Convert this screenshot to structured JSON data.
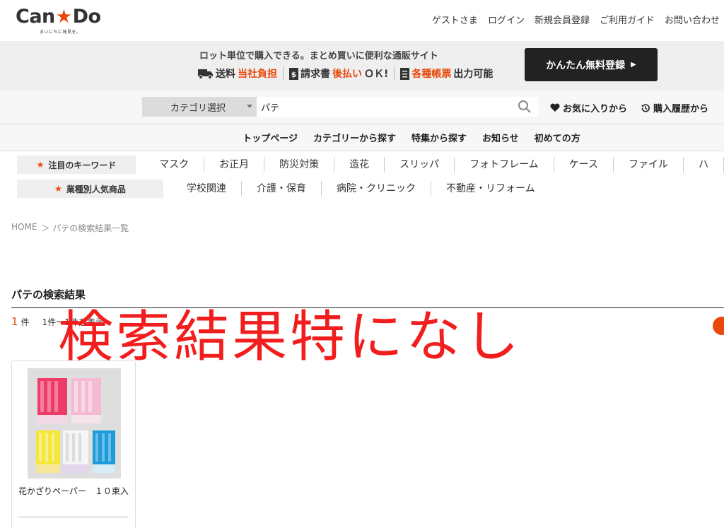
{
  "header": {
    "logo_text_1": "Can",
    "logo_text_2": "Do",
    "logo_tagline": "まいにちに発見を。",
    "nav": [
      "ゲストさま",
      "ログイン",
      "新規会員登録",
      "ご利用ガイド",
      "お問い合わせ"
    ]
  },
  "promo": {
    "title": "ロット単位で購入できる。まとめ買いに便利な通販サイト",
    "item1_a": "送料",
    "item1_b": "当社負担",
    "item2_a": "請求書",
    "item2_b": "後払い",
    "item2_c": "ＯＫ!",
    "item3_a": "各種帳票",
    "item3_b": "出力可能",
    "register_button": "かんたん無料登録"
  },
  "search": {
    "category_label": "カテゴリ選択",
    "query": "パテ",
    "favorites": "お気に入りから",
    "history": "購入履歴から"
  },
  "mainnav": [
    "トップページ",
    "カテゴリーから探す",
    "特集から探す",
    "お知らせ",
    "初めての方"
  ],
  "keywords": {
    "label": "注目のキーワード",
    "items": [
      "マスク",
      "お正月",
      "防災対策",
      "造花",
      "スリッパ",
      "フォトフレーム",
      "ケース",
      "ファイル",
      "ハ"
    ]
  },
  "industry": {
    "label": "業種別人気商品",
    "items": [
      "学校関連",
      "介護・保育",
      "病院・クリニック",
      "不動産・リフォーム"
    ]
  },
  "breadcrumb": {
    "home": "HOME",
    "current": "＞ パテの検索結果一覧"
  },
  "results": {
    "title": "パテの検索結果",
    "count": "1",
    "count_unit": "件",
    "range": "1件〜1件を表示"
  },
  "overlay_text": "検索結果特になし",
  "product": {
    "name": "花かざりペーパー　１０束入"
  },
  "colors": {
    "accent": "#e8480c",
    "overlay": "#f21e1e",
    "dark_button": "#222222"
  }
}
